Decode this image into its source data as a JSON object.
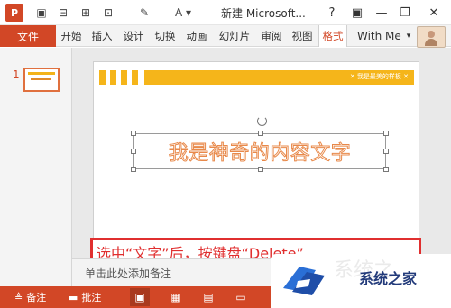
{
  "window": {
    "title": "新建 Microsoft...",
    "app_logo": "P",
    "help": "?",
    "restore_label": "▣",
    "minimize": "—",
    "close": "✕"
  },
  "quick_access": [
    {
      "name": "save-icon",
      "glyph": "▣"
    },
    {
      "name": "align-icon",
      "glyph": "⊟"
    },
    {
      "name": "align-center-icon",
      "glyph": "⊞"
    },
    {
      "name": "distribute-icon",
      "glyph": "⊡"
    },
    {
      "name": "format-painter-icon",
      "glyph": "✎"
    },
    {
      "name": "font-color-icon",
      "glyph": "A"
    }
  ],
  "ribbon": {
    "file_tab": "文件",
    "tabs": [
      "开始",
      "插入",
      "设计",
      "切换",
      "动画",
      "幻灯片",
      "审阅",
      "视图",
      "格式"
    ],
    "active_tab": "格式",
    "user": "With Me"
  },
  "thumbnails": {
    "slide_number": "1"
  },
  "slide": {
    "header_small_text": "✕ 我是最美的样板 ✕",
    "textbox_text": "我是神奇的内容文字",
    "instruction_text": "选中“文字”后，按键盘“Delete”"
  },
  "notes": {
    "placeholder": "单击此处添加备注"
  },
  "statusbar": {
    "notes_label": "备注",
    "comments_label": "批注"
  },
  "watermark": {
    "text": "系统之家",
    "faint_text": "系统之"
  },
  "colors": {
    "accent": "#d24726",
    "banner": "#f5b51a",
    "instruction_red": "#e02f2f",
    "word_outline": "#e8894a"
  }
}
